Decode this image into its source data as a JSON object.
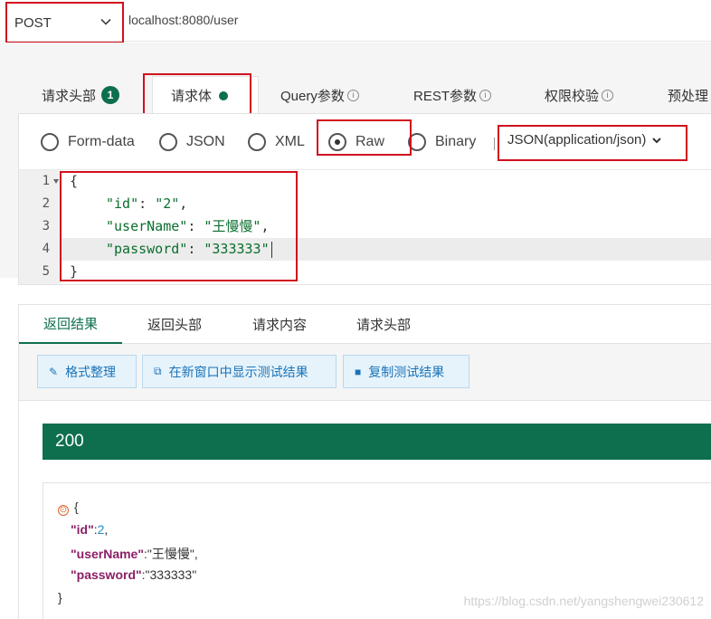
{
  "request": {
    "method": "POST",
    "url": "localhost:8080/user"
  },
  "tabs": [
    {
      "label": "请求头部",
      "badge": "1"
    },
    {
      "label": "请求体"
    },
    {
      "label": "Query参数"
    },
    {
      "label": "REST参数"
    },
    {
      "label": "权限校验"
    },
    {
      "label": "预处理"
    }
  ],
  "body_types": [
    "Form-data",
    "JSON",
    "XML",
    "Raw",
    "Binary"
  ],
  "selected_body_type": "Raw",
  "content_type": "JSON(application/json)",
  "editor": {
    "line_numbers": [
      "1",
      "2",
      "3",
      "4",
      "5"
    ],
    "lines": [
      "{",
      "\"id\": \"2\",",
      "\"userName\": \"王慢慢\",",
      "\"password\": \"333333\"",
      "}"
    ]
  },
  "response_tabs": [
    "返回结果",
    "返回头部",
    "请求内容",
    "请求头部"
  ],
  "buttons": [
    "格式整理",
    "在新窗口中显示测试结果",
    "复制测试结果"
  ],
  "status_code": "200",
  "response_json": {
    "id": "2",
    "userName": "\"王慢慢\"",
    "password": "\"333333\""
  },
  "watermark": "https://blog.csdn.net/yangshengwei230612",
  "colors": {
    "accent": "#0e6f4f",
    "highlight_border": "#d0101e",
    "button_text": "#1a73b8"
  }
}
